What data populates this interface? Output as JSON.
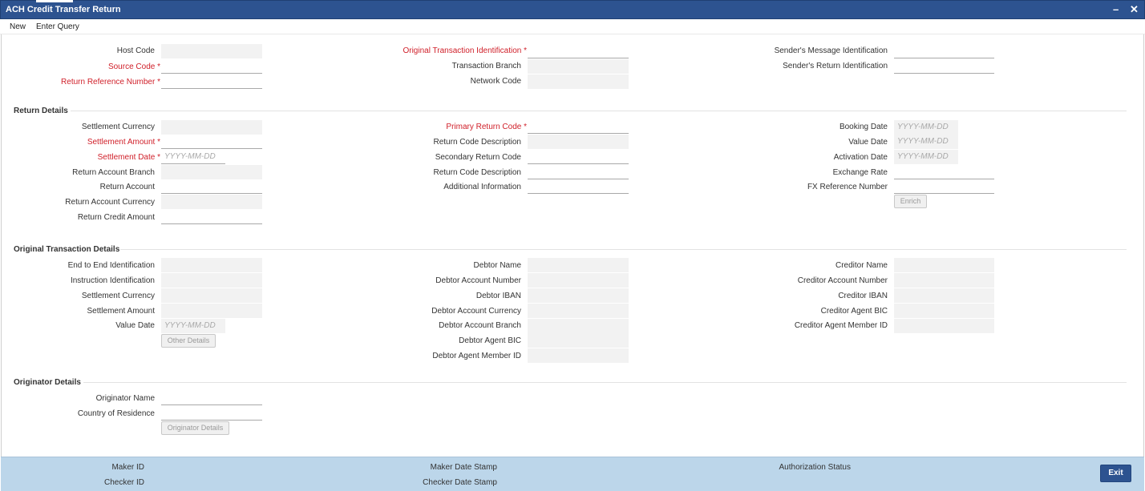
{
  "window": {
    "title": "ACH Credit Transfer Return",
    "minimize": "–",
    "close": "✕"
  },
  "menu": {
    "new": "New",
    "enter_query": "Enter Query"
  },
  "header": {
    "host_code": "Host Code",
    "source_code": "Source Code",
    "return_reference_number": "Return Reference Number",
    "original_transaction_identification": "Original Transaction Identification",
    "transaction_branch": "Transaction Branch",
    "network_code": "Network Code",
    "senders_message_identification": "Sender's Message Identification",
    "senders_return_identification": "Sender's Return Identification"
  },
  "return_details": {
    "title": "Return Details",
    "settlement_currency": "Settlement Currency",
    "settlement_amount": "Settlement Amount",
    "settlement_date": "Settlement Date",
    "return_account_branch": "Return Account Branch",
    "return_account": "Return Account",
    "return_account_currency": "Return Account Currency",
    "return_credit_amount": "Return Credit Amount",
    "primary_return_code": "Primary Return Code",
    "return_code_description_1": "Return Code Description",
    "secondary_return_code": "Secondary Return Code",
    "return_code_description_2": "Return Code Description",
    "additional_information": "Additional Information",
    "booking_date": "Booking Date",
    "value_date": "Value Date",
    "activation_date": "Activation Date",
    "exchange_rate": "Exchange Rate",
    "fx_reference_number": "FX Reference Number",
    "enrich_button": "Enrich"
  },
  "original_transaction": {
    "title": "Original Transaction Details",
    "end_to_end_identification": "End to End Identification",
    "instruction_identification": "Instruction Identification",
    "settlement_currency": "Settlement Currency",
    "settlement_amount": "Settlement Amount",
    "value_date": "Value Date",
    "other_details_button": "Other Details",
    "debtor_name": "Debtor Name",
    "debtor_account_number": "Debtor Account Number",
    "debtor_iban": "Debtor IBAN",
    "debtor_account_currency": "Debtor Account Currency",
    "debtor_account_branch": "Debtor Account Branch",
    "debtor_agent_bic": "Debtor Agent BIC",
    "debtor_agent_member_id": "Debtor Agent Member ID",
    "creditor_name": "Creditor Name",
    "creditor_account_number": "Creditor Account Number",
    "creditor_iban": "Creditor IBAN",
    "creditor_agent_bic": "Creditor Agent BIC",
    "creditor_agent_member_id": "Creditor Agent Member ID"
  },
  "originator": {
    "title": "Originator Details",
    "originator_name": "Originator Name",
    "country_of_residence": "Country of Residence",
    "originator_details_button": "Originator Details"
  },
  "date_placeholder": "YYYY-MM-DD",
  "footer": {
    "maker_id": "Maker ID",
    "checker_id": "Checker ID",
    "maker_date_stamp": "Maker Date Stamp",
    "checker_date_stamp": "Checker Date Stamp",
    "authorization_status": "Authorization Status",
    "exit_button": "Exit"
  },
  "colors": {
    "title_bar": "#2d5390",
    "required_label": "#d0202a",
    "footer_bg": "#bcd6ea"
  }
}
